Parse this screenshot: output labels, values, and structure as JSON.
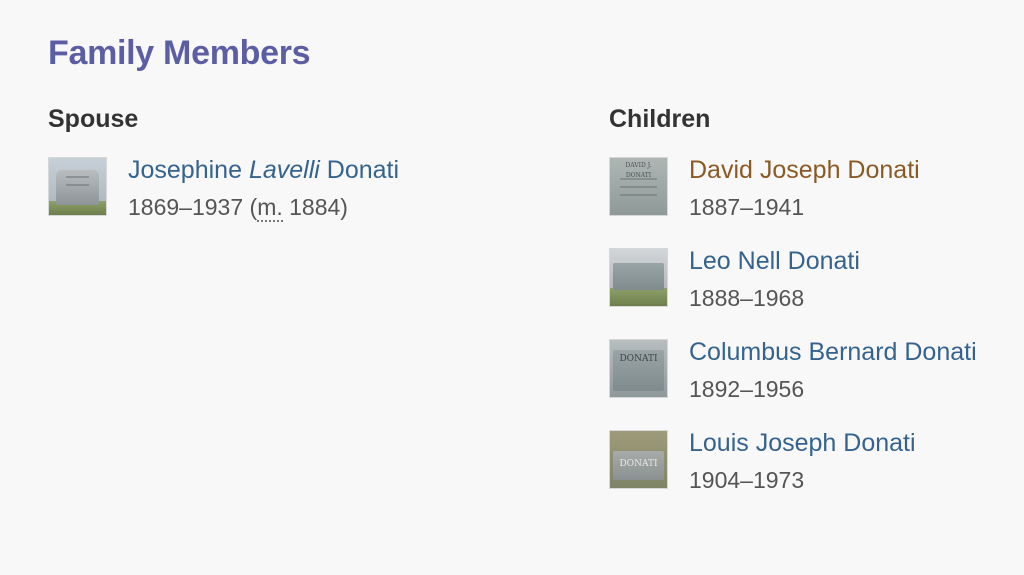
{
  "section": {
    "title": "Family Members"
  },
  "spouse": {
    "heading": "Spouse",
    "people": [
      {
        "name_first": "Josephine ",
        "name_maiden": "Lavelli",
        "name_last": " Donati",
        "years": "1869–1937",
        "marriage_open": " (",
        "marriage_abbr": "m.",
        "marriage_year": " 1884)",
        "thumb_icon": "gravestone-photo"
      }
    ]
  },
  "children": {
    "heading": "Children",
    "people": [
      {
        "name": "David Joseph Donati",
        "years": "1887–1941",
        "thumb_icon": "gravestone-photo",
        "visited": true,
        "thumb_text": "DAVID J. DONATI"
      },
      {
        "name": "Leo Nell Donati",
        "years": "1888–1968",
        "thumb_icon": "gravestone-photo",
        "visited": false,
        "thumb_text": ""
      },
      {
        "name": "Columbus Bernard Donati",
        "years": "1892–1956",
        "thumb_icon": "gravestone-photo",
        "visited": false,
        "thumb_text": "DONATI"
      },
      {
        "name": "Louis Joseph Donati",
        "years": "1904–1973",
        "thumb_icon": "gravestone-photo",
        "visited": false,
        "thumb_text": "DONATI"
      }
    ]
  },
  "colors": {
    "title": "#5c5ea3",
    "link": "#35638e",
    "visited_link": "#8b5a24",
    "text": "#555555"
  }
}
